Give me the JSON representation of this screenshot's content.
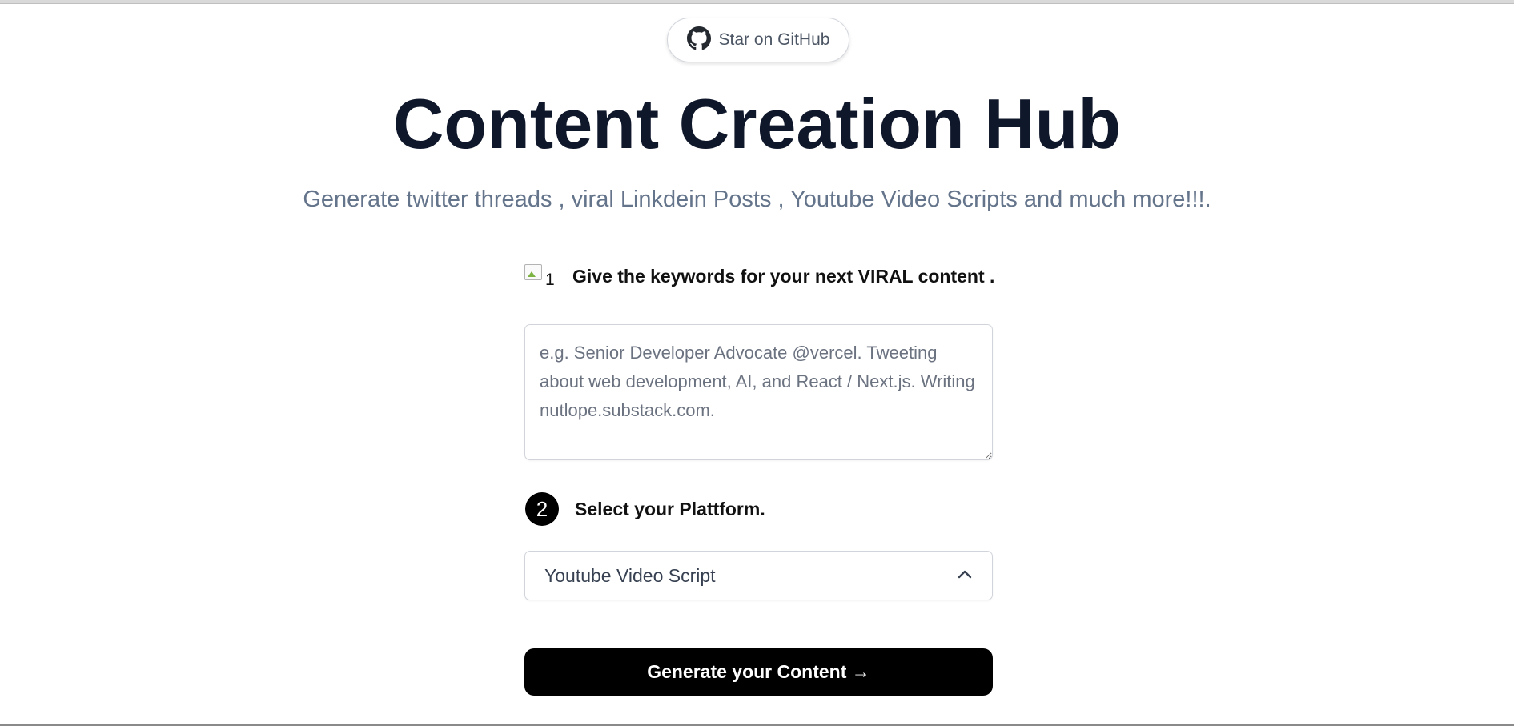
{
  "header": {
    "github_button_label": "Star on GitHub"
  },
  "hero": {
    "title": "Content Creation Hub",
    "subtitle": "Generate twitter threads , viral Linkdein Posts , Youtube Video Scripts and much more!!!."
  },
  "step1": {
    "image_alt": "1",
    "label": "Give the keywords for your next VIRAL content .",
    "textarea_value": "",
    "textarea_placeholder": "e.g. Senior Developer Advocate @vercel. Tweeting about web development, AI, and React / Next.js. Writing nutlope.substack.com."
  },
  "step2": {
    "number": "2",
    "label": "Select your Plattform.",
    "selected_value": "Youtube Video Script"
  },
  "actions": {
    "generate_label": "Generate your Content →"
  },
  "icons": {
    "github": "github-icon",
    "chevron": "chevron-up-icon"
  },
  "colors": {
    "title": "#0f172a",
    "subtitle": "#64748b",
    "button_bg": "#000000",
    "border": "#d1d5db"
  }
}
